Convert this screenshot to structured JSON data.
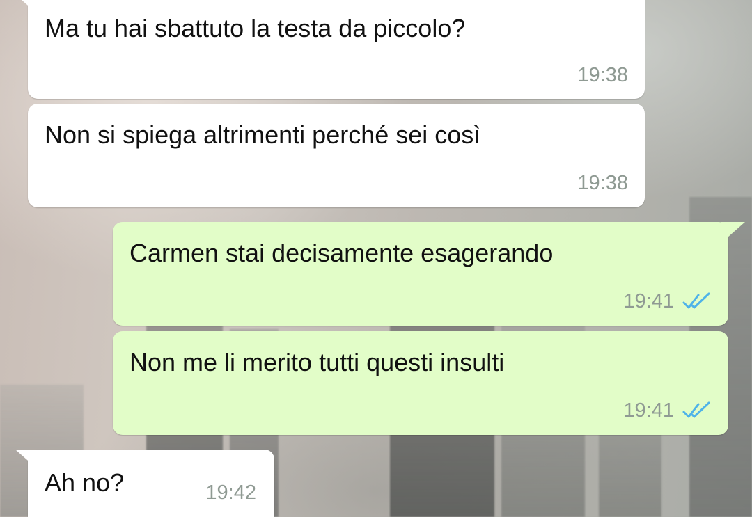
{
  "conversation": {
    "messages": [
      {
        "direction": "incoming",
        "text": "Ma tu hai sbattuto la testa da piccolo?",
        "time": "19:38"
      },
      {
        "direction": "incoming",
        "text": "Non si spiega altrimenti perché sei così",
        "time": "19:38"
      },
      {
        "direction": "outgoing",
        "text": "Carmen stai decisamente esagerando",
        "time": "19:41",
        "status_icon": "double-check-read-icon"
      },
      {
        "direction": "outgoing",
        "text": "Non me li merito tutti questi insulti",
        "time": "19:41",
        "status_icon": "double-check-read-icon"
      },
      {
        "direction": "incoming",
        "text": "Ah no?",
        "time": "19:42"
      }
    ]
  },
  "colors": {
    "incoming_bubble": "#ffffff",
    "outgoing_bubble": "#e2fdc8",
    "read_tick": "#4fb3e8",
    "timestamp": "#8f9a93"
  }
}
